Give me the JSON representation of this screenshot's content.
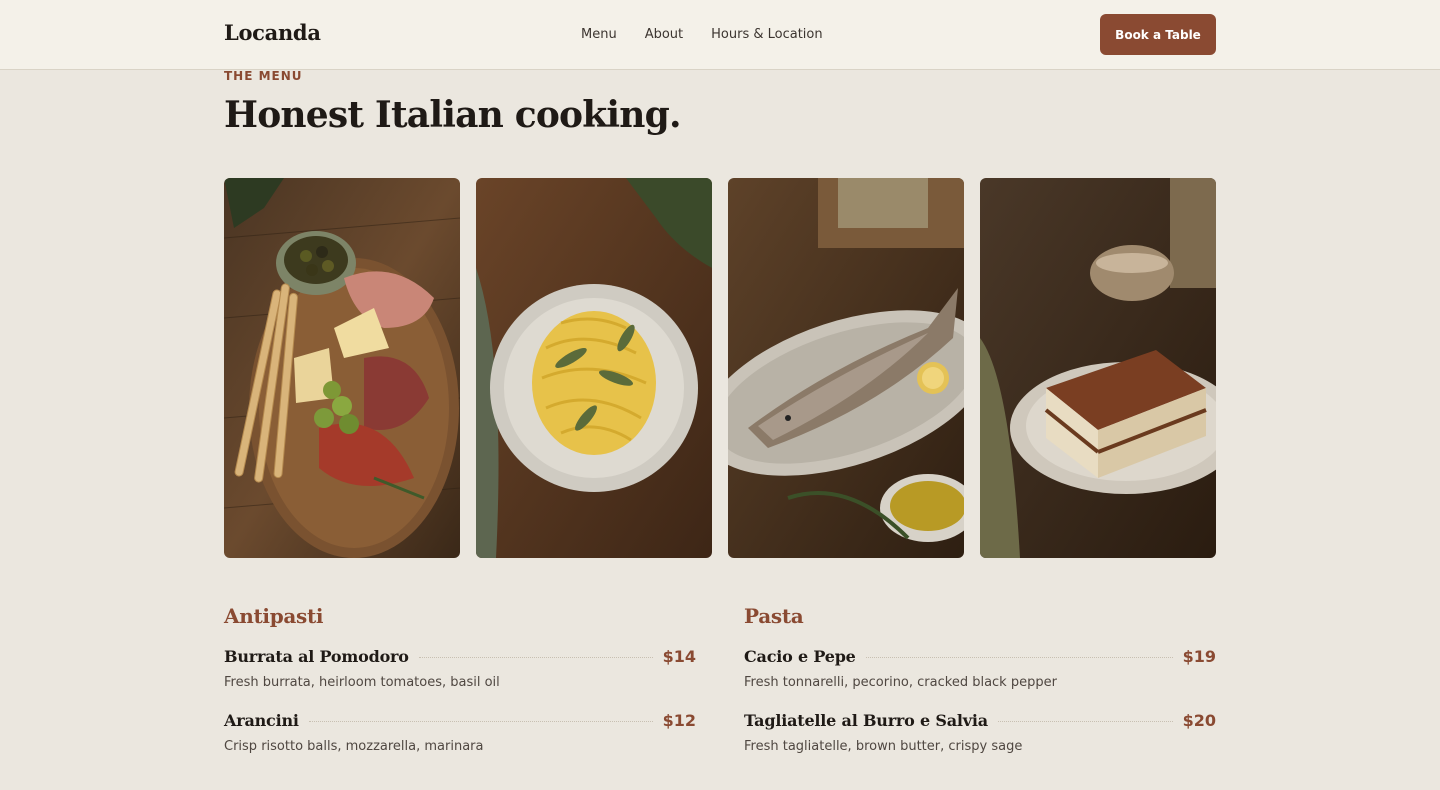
{
  "header": {
    "logo": "Locanda",
    "nav": [
      "Menu",
      "About",
      "Hours & Location"
    ],
    "cta": "Book a Table"
  },
  "intro": {
    "eyebrow": "THE MENU",
    "headline": "Honest Italian cooking."
  },
  "photos": [
    {
      "name": "antipasti-board-photo"
    },
    {
      "name": "tagliatelle-photo"
    },
    {
      "name": "grilled-fish-photo"
    },
    {
      "name": "tiramisu-photo"
    }
  ],
  "menu": {
    "antipasti": {
      "title": "Antipasti",
      "items": [
        {
          "name": "Burrata al Pomodoro",
          "price": "$14",
          "desc": "Fresh burrata, heirloom tomatoes, basil oil"
        },
        {
          "name": "Arancini",
          "price": "$12",
          "desc": "Crisp risotto balls, mozzarella, marinara"
        }
      ]
    },
    "pasta": {
      "title": "Pasta",
      "items": [
        {
          "name": "Cacio e Pepe",
          "price": "$19",
          "desc": "Fresh tonnarelli, pecorino, cracked black pepper"
        },
        {
          "name": "Tagliatelle al Burro e Salvia",
          "price": "$20",
          "desc": "Fresh tagliatelle, brown butter, crispy sage"
        }
      ]
    }
  },
  "colors": {
    "accent": "#8a4a32",
    "background": "#ebe7df",
    "header_bg": "#f4f1e9"
  }
}
